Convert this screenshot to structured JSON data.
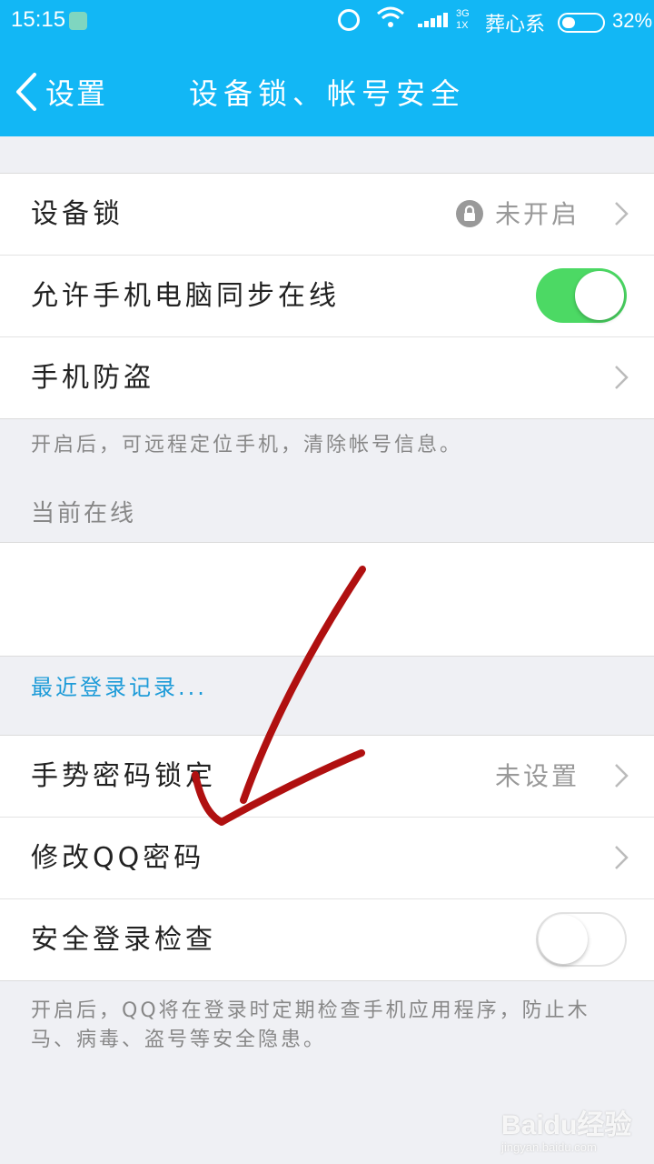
{
  "status_bar": {
    "time": "15:15",
    "network_top": "3G",
    "network_bottom": "1X",
    "carrier": "葬心系",
    "battery_percent": "32%",
    "battery_level": 0.32
  },
  "nav": {
    "back_label": "设置",
    "title": "设备锁、帐号安全"
  },
  "group1": {
    "device_lock": {
      "label": "设备锁",
      "value": "未开启"
    },
    "sync_online": {
      "label": "允许手机电脑同步在线",
      "toggle_on": true
    },
    "anti_theft": {
      "label": "手机防盗"
    }
  },
  "anti_theft_note": "开启后，可远程定位手机，清除帐号信息。",
  "current_online_header": "当前在线",
  "online_device_partial": "",
  "recent_login_link": "最近登录记录...",
  "group2": {
    "gesture_lock": {
      "label": "手势密码锁定",
      "value": "未设置"
    },
    "change_password": {
      "label": "修改QQ密码"
    },
    "safe_login_check": {
      "label": "安全登录检查",
      "toggle_on": false
    }
  },
  "safe_login_note": "开启后，QQ将在登录时定期检查手机应用程序，防止木马、病毒、盗号等安全隐患。",
  "watermark": {
    "brand": "Baidu经验",
    "url": "jingyan.baidu.com"
  },
  "colors": {
    "header_bg": "#12b7f5",
    "toggle_on": "#4cd964",
    "link": "#1d9bd8",
    "annotation": "#b01010"
  }
}
